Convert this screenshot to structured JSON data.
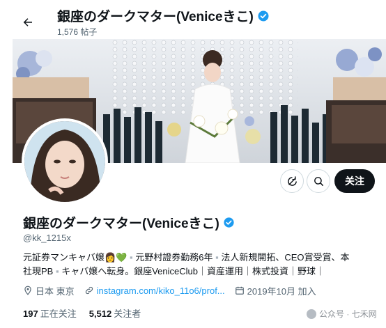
{
  "header": {
    "title": "銀座のダークマター(Veniceきこ)",
    "post_count": "1,576 帖子"
  },
  "profile": {
    "name": "銀座のダークマター(Veniceきこ)",
    "handle": "@kk_1215x",
    "bio_line1_a": "元証券マンキャバ嬢",
    "bio_line1_b": "元野村證券勤務6年",
    "bio_line1_c": "法人新規開拓、CEO賞受賞、本",
    "bio_line2_a": "社現PB",
    "bio_line2_b": "キャバ嬢へ転身。銀座VeniceClub｜資産運用｜株式投資｜野球｜",
    "location": "日本 東京",
    "link": "instagram.com/kiko_11o6/prof...",
    "joined": "2019年10月 加入",
    "following_count": "197",
    "following_label": "正在关注",
    "followers_count": "5,512",
    "followers_label": "关注者"
  },
  "actions": {
    "follow_label": "关注"
  },
  "watermark": {
    "text": "公众号 · 七禾网"
  },
  "colors": {
    "verified": "#1d9bf0",
    "link": "#1d9bf0",
    "follow_bg": "#0f1419",
    "muted": "#536471"
  },
  "icons": [
    "back-arrow-icon",
    "verified-badge-icon",
    "subscribe-icon",
    "search-icon",
    "location-icon",
    "link-icon",
    "calendar-icon"
  ]
}
